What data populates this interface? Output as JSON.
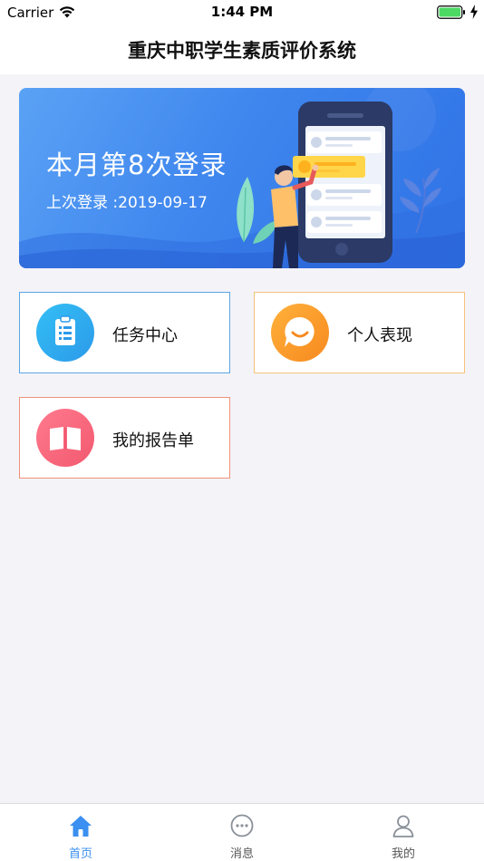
{
  "status_bar": {
    "carrier": "Carrier",
    "time": "1:44 PM",
    "wifi_icon": "wifi-icon",
    "battery_icon": "battery-full-icon",
    "battery_color": "#4cd964"
  },
  "nav": {
    "title": "重庆中职学生素质评价系统"
  },
  "banner": {
    "title": "本月第8次登录",
    "subtitle": "上次登录 :2019-09-17",
    "colors": {
      "start": "#5aa2f5",
      "end": "#2f72e6"
    }
  },
  "menu": {
    "items": [
      {
        "label": "任务中心",
        "icon": "clipboard-icon",
        "color": "#2c9ae9",
        "border": "#5ba5e3"
      },
      {
        "label": "个人表现",
        "icon": "smile-chat-icon",
        "color": "#f7891f",
        "border": "#f5c27a"
      },
      {
        "label": "我的报告单",
        "icon": "book-icon",
        "color": "#f2596f",
        "border": "#f09179"
      }
    ]
  },
  "tabbar": {
    "items": [
      {
        "label": "首页",
        "icon": "home-icon",
        "active": true
      },
      {
        "label": "消息",
        "icon": "message-icon",
        "active": false
      },
      {
        "label": "我的",
        "icon": "user-icon",
        "active": false
      }
    ],
    "active_color": "#3a8ff0",
    "inactive_color": "#8a9099"
  }
}
